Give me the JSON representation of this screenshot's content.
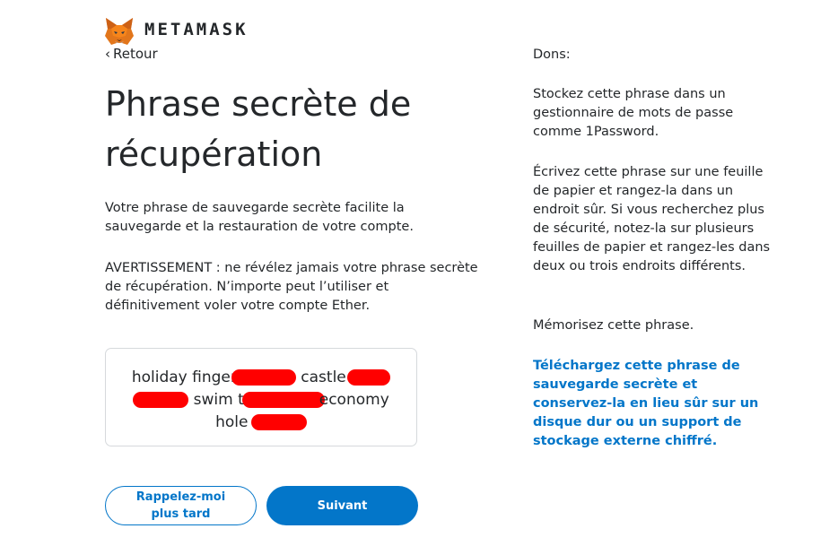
{
  "header": {
    "brand": "METAMASK",
    "back_label": "Retour"
  },
  "main": {
    "title": "Phrase secrète de récupération",
    "intro": "Votre phrase de sauvegarde secrète facilite la sauvegarde et la restauration de votre compte.",
    "warning": "AVERTISSEMENT : ne révélez jamais votre phrase secrète de récupération. N’importe peut l’utiliser et définitivement voler votre compte Ether."
  },
  "seed": {
    "line1": [
      "holiday",
      "finger",
      "castle"
    ],
    "line2": [
      "swim",
      "t",
      "economy"
    ],
    "line3": [
      "hole"
    ]
  },
  "buttons": {
    "later_label": "Rappelez-moi plus tard",
    "next_label": "Suivant"
  },
  "tips": {
    "heading": "Dons:",
    "tip1": "Stockez cette phrase dans un gestionnaire de mots de passe comme 1Password.",
    "tip2": "Écrivez cette phrase sur une feuille de papier et rangez-la dans un endroit sûr. Si vous recherchez plus de sécurité, notez-la sur plusieurs feuilles de papier et rangez-les dans deux ou trois endroits différents.",
    "tip3": "Mémorisez cette phrase.",
    "download_link": "Téléchargez cette phrase de sauvegarde secrète et conservez-la en lieu sûr sur un disque dur ou un support de stockage externe chiffré."
  },
  "colors": {
    "accent": "#0376c9",
    "redaction": "#ff0000",
    "text": "#24272a",
    "border": "#d6d9dc"
  },
  "icons": {
    "logo": "metamask-fox-icon",
    "back": "chevron-left-icon"
  }
}
